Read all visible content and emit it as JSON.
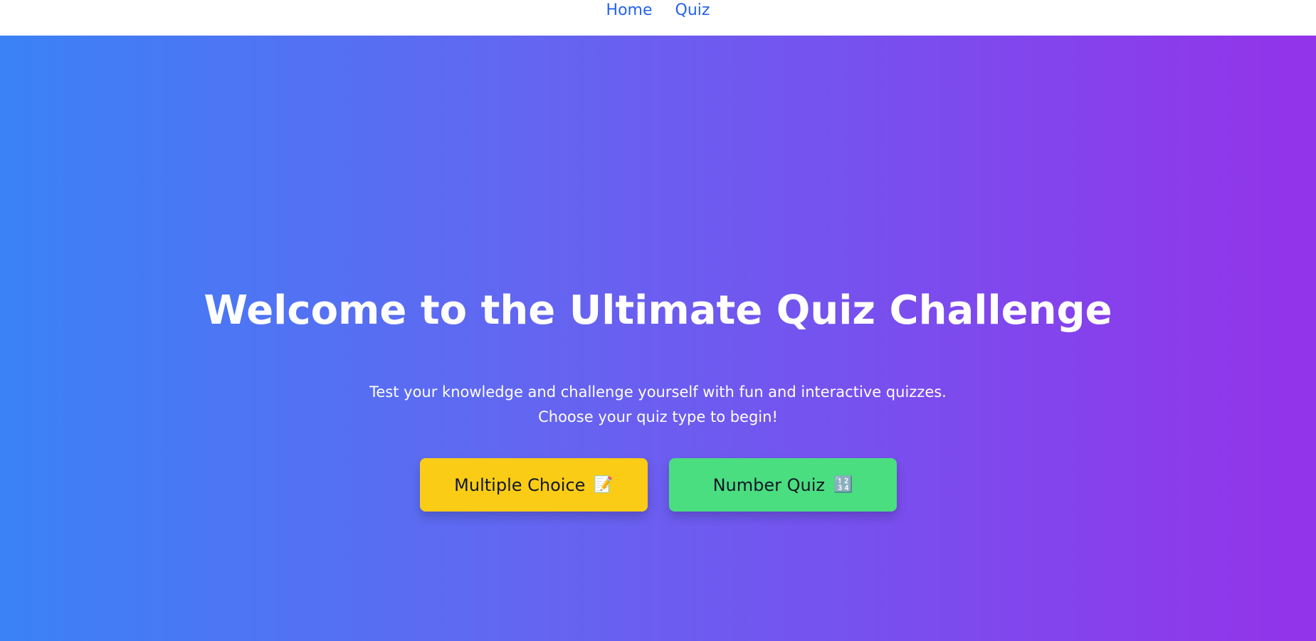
{
  "nav": {
    "items": [
      {
        "label": "Home"
      },
      {
        "label": "Quiz"
      }
    ]
  },
  "hero": {
    "title": "Welcome to the Ultimate Quiz Challenge",
    "subtitle": "Test your knowledge and challenge yourself with fun and interactive quizzes. Choose your quiz type to begin!",
    "buttons": [
      {
        "label": "Multiple Choice",
        "icon": "📝",
        "icon_name": "memo-icon",
        "color": "#facc15"
      },
      {
        "label": "Number Quiz",
        "icon": "🔢",
        "icon_name": "number-input-icon",
        "color": "#4ade80"
      }
    ]
  },
  "colors": {
    "nav_link": "#2563eb",
    "gradient_start": "#3b82f6",
    "gradient_mid": "#6366f1",
    "gradient_end": "#9333ea"
  }
}
